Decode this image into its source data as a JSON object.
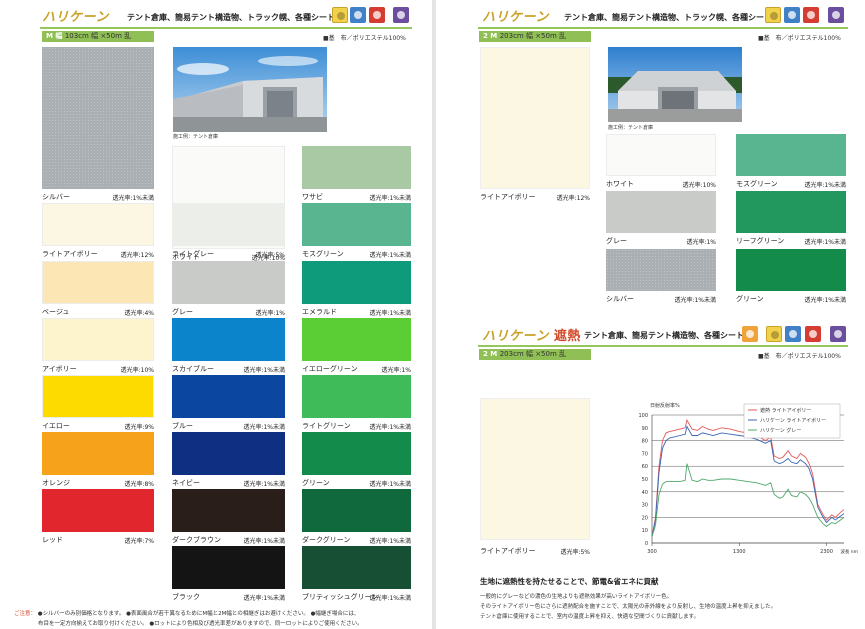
{
  "left": {
    "brand": "ハリケーン",
    "title": "テント倉庫、簡易テント構造物、トラック幌、各種シート等",
    "icons": [
      {
        "name": "two-side-icon",
        "text": "2ッ面防汚",
        "color": "#f3d24b"
      },
      {
        "name": "waterproof-icon",
        "text": "防水",
        "color": "#3f80c6"
      },
      {
        "name": "flame-retardant-icon",
        "text": "防炎",
        "color": "#d63d32"
      },
      {
        "name": "uv-icon",
        "text": "UV",
        "color": "#6b4f9e"
      }
    ],
    "width_label": "M 幅",
    "width_size": "103cm 幅 ×50m 乱",
    "fabric": "■基　布／ポリエステル100%",
    "photo_caption": "施工例：テント倉庫",
    "swatches": [
      {
        "name": "シルバー",
        "trans": "透光率:1%未満",
        "color": "#a9afb3"
      },
      {
        "name": "ライトアイボリー",
        "trans": "透光率:12%",
        "color": "#fbf7e3"
      },
      {
        "name": "ベージュ",
        "trans": "透光率:4%",
        "color": "#fbe6b4"
      },
      {
        "name": "アイボリー",
        "trans": "透光率:10%",
        "color": "#fdf3cd"
      },
      {
        "name": "イエロー",
        "trans": "透光率:9%",
        "color": "#fedb00"
      },
      {
        "name": "オレンジ",
        "trans": "透光率:8%",
        "color": "#f7a21b"
      },
      {
        "name": "レッド",
        "trans": "透光率:7%",
        "color": "#e1262e"
      },
      {
        "name": "ホワイト",
        "trans": "透光率:10%",
        "color": "#fafaf8"
      },
      {
        "name": "ライトグレー",
        "trans": "透光率:5%",
        "color": "#eceeea"
      },
      {
        "name": "グレー",
        "trans": "透光率:1%",
        "color": "#c8cbc8"
      },
      {
        "name": "スカイブルー",
        "trans": "透光率:1%未満",
        "color": "#0b84cc"
      },
      {
        "name": "ブルー",
        "trans": "透光率:1%未満",
        "color": "#0b47a0"
      },
      {
        "name": "ネイビー",
        "trans": "透光率:1%未満",
        "color": "#0f2f82"
      },
      {
        "name": "ダークブラウン",
        "trans": "透光率:1%未満",
        "color": "#2a1e1b"
      },
      {
        "name": "ブラック",
        "trans": "透光率:1%未満",
        "color": "#141414"
      },
      {
        "name": "ワサビ",
        "trans": "透光率:1%未満",
        "color": "#a8c9a3"
      },
      {
        "name": "モスグリーン",
        "trans": "透光率:1%未満",
        "color": "#59b58f"
      },
      {
        "name": "エメラルド",
        "trans": "透光率:1%未満",
        "color": "#0e9b7c"
      },
      {
        "name": "イエローグリーン",
        "trans": "透光率:1%",
        "color": "#5cce35"
      },
      {
        "name": "ライトグリーン",
        "trans": "透光率:1%未満",
        "color": "#3fbb5a"
      },
      {
        "name": "グリーン",
        "trans": "透光率:1%未満",
        "color": "#138b4b"
      },
      {
        "name": "ダークグリーン",
        "trans": "透光率:1%未満",
        "color": "#10683d"
      },
      {
        "name": "ブリティッシュグリーン",
        "trans": "透光率:1%未満",
        "color": "#174f35"
      }
    ],
    "notes_label": "ご注意：",
    "note1": "●シルバーのみ別価格となります。",
    "note2": "●表面風合が若干異なるためにM幅と2M幅との相継ぎはお避けください。",
    "note3": "●幅継ぎ場合には、",
    "note4": "布目を一定方向揃えてお取り付けください。",
    "note5": "●ロットにより色相及び透光率差がありますので、同一ロットによりご使用ください。"
  },
  "right": {
    "brand": "ハリケーン",
    "title": "テント倉庫、簡易テント構造物、トラック幌、各種シート等",
    "icons": [
      {
        "name": "two-side-icon",
        "text": "2ッ面防汚",
        "color": "#f3d24b"
      },
      {
        "name": "waterproof-icon",
        "text": "防水",
        "color": "#3f80c6"
      },
      {
        "name": "flame-retardant-icon",
        "text": "防炎",
        "color": "#d63d32"
      },
      {
        "name": "uv-icon",
        "text": "UV",
        "color": "#6b4f9e"
      }
    ],
    "width_label": "2 M",
    "width_size": "203cm 幅 ×50m 乱",
    "fabric": "■基　布／ポリエステル100%",
    "photo_caption": "施工例：テント倉庫",
    "big_swatch": {
      "name": "ライトアイボリー",
      "trans": "透光率:12%",
      "color": "#fbf7e3"
    },
    "swatches": [
      {
        "name": "ホワイト",
        "trans": "透光率:10%",
        "color": "#fafaf8"
      },
      {
        "name": "グレー",
        "trans": "透光率:1%",
        "color": "#c8cbc8"
      },
      {
        "name": "シルバー",
        "trans": "透光率:1%未満",
        "color": "#a9afb3"
      },
      {
        "name": "モスグリーン",
        "trans": "透光率:1%未満",
        "color": "#59b58f"
      },
      {
        "name": "リーフグリーン",
        "trans": "透光率:1%未満",
        "color": "#22975e"
      },
      {
        "name": "グリーン",
        "trans": "透光率:1%未満",
        "color": "#138b4b"
      }
    ],
    "shade": {
      "brand": "ハリケーン",
      "brand_sub": "遮熱",
      "title": "テント倉庫、簡易テント構造物、各種シート等",
      "icons": [
        {
          "name": "heat-shield-icon",
          "text": "遮熱",
          "color": "#f0a23b"
        },
        {
          "name": "two-side-icon",
          "text": "2ッ面防汚",
          "color": "#f3d24b"
        },
        {
          "name": "waterproof-icon",
          "text": "防水",
          "color": "#3f80c6"
        },
        {
          "name": "flame-retardant-icon",
          "text": "防炎",
          "color": "#d63d32"
        },
        {
          "name": "uv-icon",
          "text": "UV",
          "color": "#6b4f9e"
        }
      ],
      "width_label": "2 M",
      "width_size": "203cm 幅 ×50m 乱",
      "fabric": "■基　布／ポリエステル100%",
      "swatch": {
        "name": "ライトアイボリー",
        "trans": "透光率:5%",
        "color": "#fbf7e3"
      },
      "headline": "生地に遮熱性を持たせることで、節電&省エネに貢献",
      "body1": "一般的にグレーなどの濃色の生地よりも遮熱効果が高いライトアイボリー色。",
      "body2": "そのライトアイボリー色にさらに遮熱配合を施すことで、太陽光の赤外線をより反射し、生地の温度上昇を抑えました。",
      "body3": "テント倉庫に使用することで、室内の温度上昇を抑え、快適な空間づくりに貢献します。"
    }
  },
  "chart_data": {
    "type": "line",
    "ylabel": "日射反射率%",
    "xlabel": "波長 nm",
    "x_ticks": [
      300,
      1300,
      2300
    ],
    "y_ticks": [
      0,
      10,
      20,
      30,
      40,
      50,
      60,
      70,
      80,
      90,
      100
    ],
    "xlim": [
      300,
      2500
    ],
    "ylim": [
      0,
      100
    ],
    "series": [
      {
        "name": "遮熱 ライトアイボリー",
        "color": "#e05a5a",
        "x": [
          300,
          340,
          380,
          420,
          460,
          500,
          560,
          620,
          680,
          700,
          760,
          820,
          880,
          940,
          1000,
          1100,
          1200,
          1300,
          1400,
          1500,
          1600,
          1660,
          1700,
          1760,
          1800,
          1860,
          1900,
          1960,
          2000,
          2060,
          2100,
          2140,
          2200,
          2260,
          2300,
          2360,
          2400,
          2460,
          2500
        ],
        "y": [
          5,
          20,
          60,
          80,
          86,
          87,
          88,
          89,
          90,
          96,
          89,
          88,
          91,
          89,
          88,
          90,
          89,
          87,
          86,
          84,
          80,
          83,
          68,
          66,
          67,
          72,
          68,
          66,
          70,
          67,
          62,
          54,
          30,
          22,
          18,
          22,
          20,
          24,
          26
        ]
      },
      {
        "name": "ハリケーン ライトアイボリー",
        "color": "#3b66b3",
        "x": [
          300,
          340,
          380,
          420,
          460,
          500,
          560,
          620,
          680,
          700,
          760,
          820,
          880,
          940,
          1000,
          1100,
          1200,
          1300,
          1400,
          1500,
          1600,
          1660,
          1700,
          1760,
          1800,
          1860,
          1900,
          1960,
          2000,
          2060,
          2100,
          2140,
          2200,
          2260,
          2300,
          2360,
          2400,
          2460,
          2500
        ],
        "y": [
          5,
          18,
          55,
          74,
          80,
          82,
          83,
          84,
          85,
          91,
          84,
          84,
          86,
          85,
          84,
          86,
          85,
          84,
          83,
          81,
          78,
          80,
          64,
          62,
          63,
          66,
          63,
          62,
          65,
          62,
          58,
          50,
          28,
          20,
          16,
          20,
          18,
          21,
          23
        ]
      },
      {
        "name": "ハリケーン グレー",
        "color": "#4fa86a",
        "x": [
          300,
          340,
          380,
          420,
          460,
          500,
          560,
          620,
          680,
          700,
          760,
          820,
          880,
          940,
          1000,
          1100,
          1200,
          1300,
          1400,
          1500,
          1600,
          1660,
          1700,
          1760,
          1800,
          1860,
          1900,
          1960,
          2000,
          2060,
          2100,
          2140,
          2200,
          2260,
          2300,
          2360,
          2400,
          2460,
          2500
        ],
        "y": [
          5,
          14,
          38,
          46,
          48,
          48,
          48,
          48,
          49,
          62,
          49,
          48,
          50,
          49,
          49,
          50,
          50,
          49,
          48,
          47,
          45,
          47,
          38,
          35,
          36,
          42,
          37,
          36,
          40,
          38,
          35,
          30,
          20,
          15,
          13,
          16,
          15,
          18,
          20
        ]
      }
    ]
  }
}
